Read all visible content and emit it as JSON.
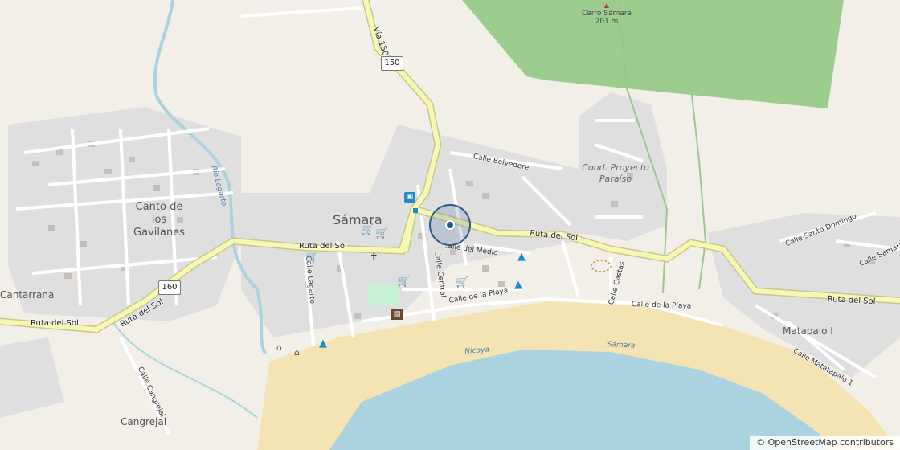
{
  "places": {
    "samara": "Sámara",
    "canto_de_los_gavilanes": "Canto de los Gavilanes",
    "cantarrana": "Cantarrana",
    "cangrejal": "Cangrejal",
    "matapalo": "Matapalo I",
    "cond_proyecto_paraiso": "Cond. Proyecto Paraíso",
    "cerro_samara_name": "Cerro Sámara",
    "cerro_samara_elevation": "203 m"
  },
  "roads": {
    "ruta_del_sol": "Ruta del Sol",
    "via_150": "Vía 150",
    "shield_150": "150",
    "shield_160": "160",
    "calle_belvedere": "Calle Belvedere",
    "calle_del_medio": "Calle del Medio",
    "calle_central": "Calle Central",
    "calle_de_la_playa": "Calle de la Playa",
    "calle_lagarto": "Calle Lagarto",
    "calle_cangrejal": "Calle Cangrejal",
    "calle_castas": "Calle Castas",
    "calle_santo_domingo": "Calle Santo Domingo",
    "calle_samara_r": "Calle Samara R",
    "calle_matatapalo": "Calle Matatapalo 1"
  },
  "water": {
    "rio_lagarto": "Río Lagarto",
    "nicoya": "Nicoya",
    "samara_bay": "Sámara"
  },
  "poi_icons": [
    "shopping-cart-icon",
    "church-icon",
    "camping-icon",
    "bus-stop-icon",
    "museum-icon"
  ],
  "colors": {
    "land": "#f2efe9",
    "residential": "#dcdcdc",
    "forest": "#8dc77f",
    "sand": "#f5e4b3",
    "sea": "#aad3df",
    "river": "#aad3df",
    "major_road": "#f7f7b4",
    "shop_icon": "#ac39ac",
    "camp_icon": "#1d8ad0",
    "park": "#c7f1d5"
  },
  "attribution": "© OpenStreetMap contributors"
}
